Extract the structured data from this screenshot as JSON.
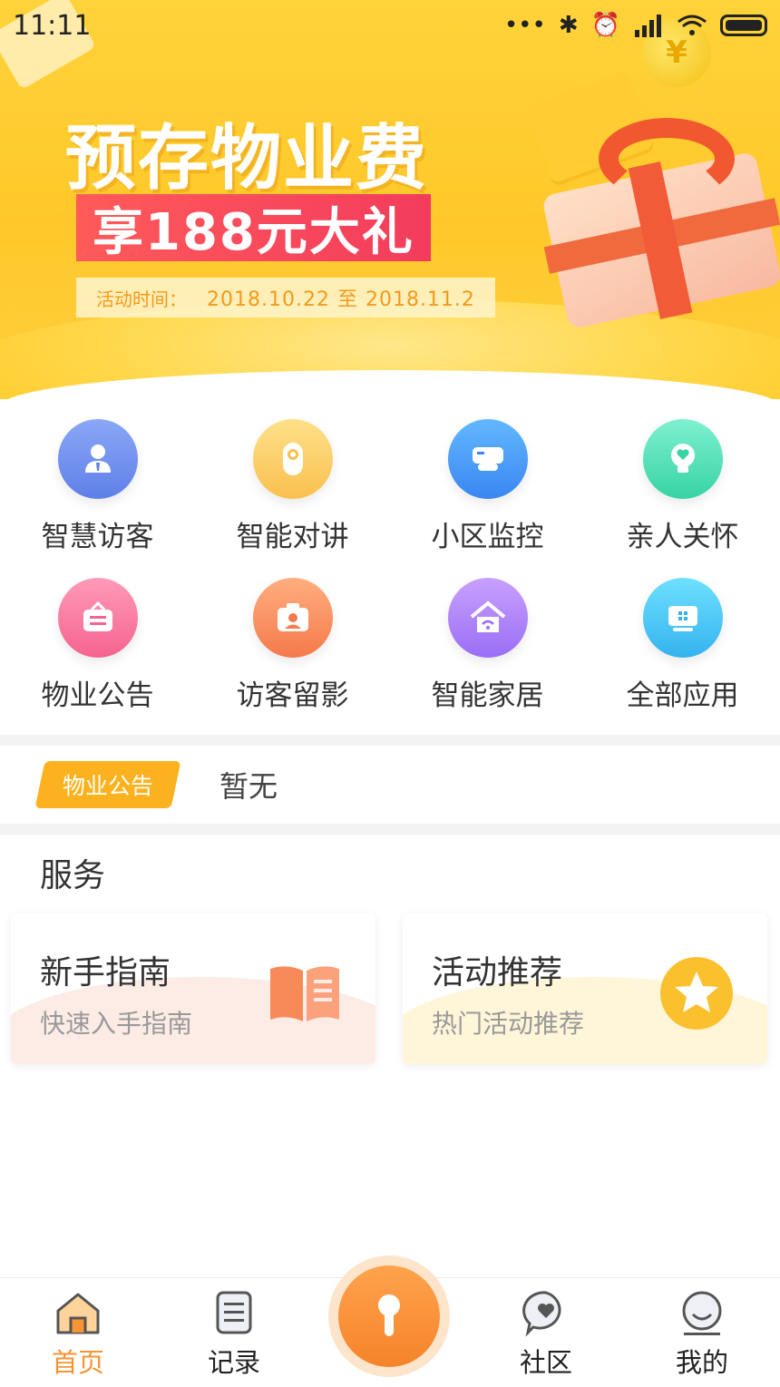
{
  "status_bar": {
    "time": "11:11",
    "icons": [
      "dots-icon",
      "bluetooth-icon",
      "alarm-icon",
      "signal-icon",
      "wifi-icon",
      "battery-icon"
    ]
  },
  "banner": {
    "title": "预存物业费",
    "subtitle": "享188元大礼",
    "time_label": "活动时间：",
    "time_range": "2018.10.22 至 2018.11.2",
    "coin": "¥"
  },
  "grid": {
    "items": [
      {
        "label": "智慧访客",
        "icon": "visitor-icon",
        "color_from": "#8aa8f6",
        "color_to": "#5f7fe9"
      },
      {
        "label": "智能对讲",
        "icon": "intercom-icon",
        "color_from": "#ffe08a",
        "color_to": "#f9c04f"
      },
      {
        "label": "小区监控",
        "icon": "camera-monitor-icon",
        "color_from": "#63b8ff",
        "color_to": "#3a86f2"
      },
      {
        "label": "亲人关怀",
        "icon": "lightbulb-heart-icon",
        "color_from": "#7ff0d0",
        "color_to": "#37d3a6"
      },
      {
        "label": "物业公告",
        "icon": "notice-bag-icon",
        "color_from": "#ff9bb8",
        "color_to": "#f5638f"
      },
      {
        "label": "访客留影",
        "icon": "photo-camera-icon",
        "color_from": "#ffae7e",
        "color_to": "#f57a4c"
      },
      {
        "label": "智能家居",
        "icon": "smart-home-icon",
        "color_from": "#c9a0ff",
        "color_to": "#9a6ef5"
      },
      {
        "label": "全部应用",
        "icon": "all-apps-icon",
        "color_from": "#6fe0ff",
        "color_to": "#33b3ee"
      }
    ]
  },
  "notice": {
    "tag": "物业公告",
    "text": "暂无"
  },
  "services": {
    "title": "服务",
    "cards": [
      {
        "title": "新手指南",
        "subtitle": "快速入手指南",
        "icon": "book-icon",
        "wave": "#fde7e0"
      },
      {
        "title": "活动推荐",
        "subtitle": "热门活动推荐",
        "icon": "star-icon",
        "wave": "#fff3d0"
      }
    ]
  },
  "tabbar": {
    "tabs": [
      {
        "label": "首页",
        "icon": "home-icon",
        "active": true
      },
      {
        "label": "记录",
        "icon": "record-icon",
        "active": false
      },
      {
        "label": "社区",
        "icon": "community-icon",
        "active": false
      },
      {
        "label": "我的",
        "icon": "profile-icon",
        "active": false
      }
    ],
    "center_icon": "key-icon"
  },
  "colors": {
    "accent": "#f89433",
    "notice_tag": "#fbb21e",
    "banner_yellow": "#ffc82a"
  }
}
